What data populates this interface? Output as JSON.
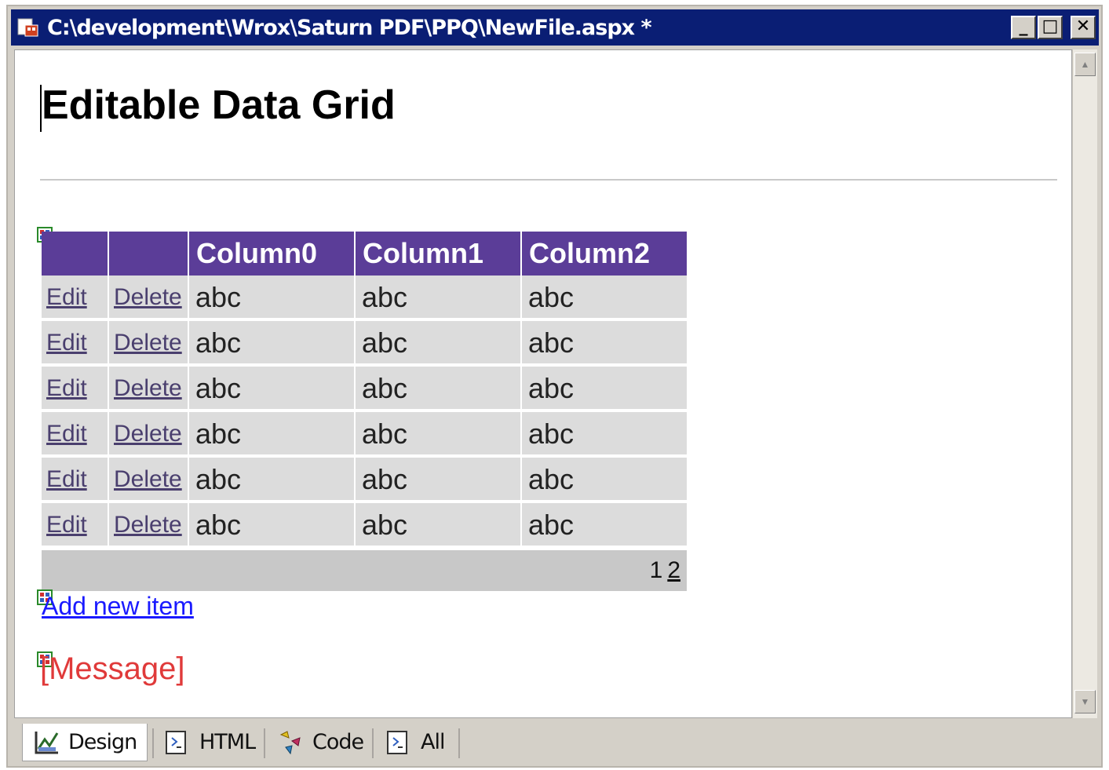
{
  "window": {
    "title": "C:\\development\\Wrox\\Saturn PDF\\PPQ\\NewFile.aspx *",
    "buttons": {
      "minimize": "_",
      "maximize": "□",
      "close": "✕"
    }
  },
  "page": {
    "title": "Editable Data Grid"
  },
  "grid": {
    "headers": [
      "",
      "",
      "Column0",
      "Column1",
      "Column2"
    ],
    "rows": [
      {
        "edit": "Edit",
        "delete": "Delete",
        "c0": "abc",
        "c1": "abc",
        "c2": "abc"
      },
      {
        "edit": "Edit",
        "delete": "Delete",
        "c0": "abc",
        "c1": "abc",
        "c2": "abc"
      },
      {
        "edit": "Edit",
        "delete": "Delete",
        "c0": "abc",
        "c1": "abc",
        "c2": "abc"
      },
      {
        "edit": "Edit",
        "delete": "Delete",
        "c0": "abc",
        "c1": "abc",
        "c2": "abc"
      },
      {
        "edit": "Edit",
        "delete": "Delete",
        "c0": "abc",
        "c1": "abc",
        "c2": "abc"
      },
      {
        "edit": "Edit",
        "delete": "Delete",
        "c0": "abc",
        "c1": "abc",
        "c2": "abc"
      }
    ],
    "pager": {
      "current": "1",
      "next": "2"
    }
  },
  "add_link": "Add new item",
  "message_label": "[Message]",
  "tabs": [
    {
      "label": "Design",
      "icon": "design-icon",
      "active": true
    },
    {
      "label": "HTML",
      "icon": "html-icon",
      "active": false
    },
    {
      "label": "Code",
      "icon": "code-icon",
      "active": false
    },
    {
      "label": "All",
      "icon": "all-icon",
      "active": false
    }
  ],
  "colors": {
    "titlebar": "#0a1e74",
    "grid_header": "#5b3d98",
    "grid_row": "#dcdcdc",
    "pager": "#c8c8c8",
    "link": "#1a1aff",
    "message": "#e03a3a"
  }
}
